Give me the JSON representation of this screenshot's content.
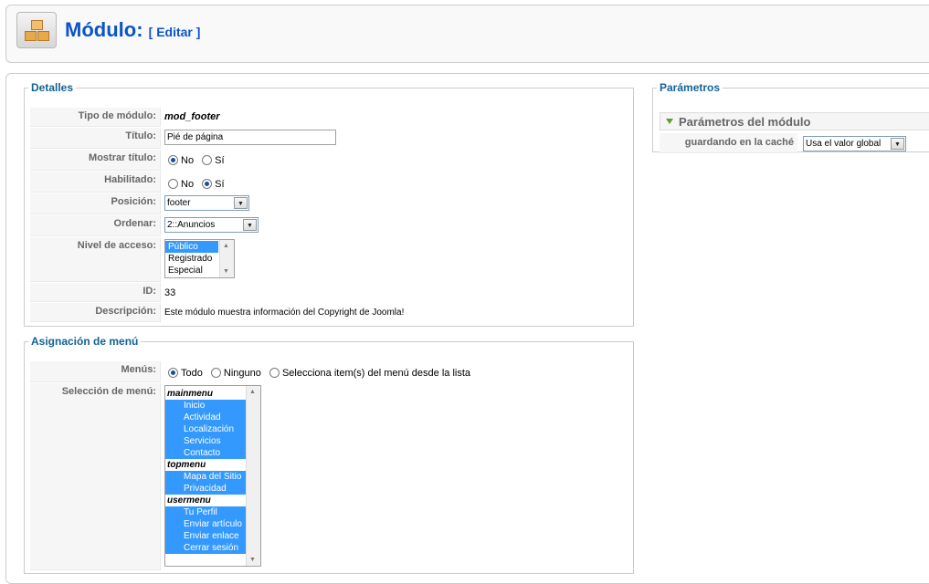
{
  "header": {
    "title": "Módulo:",
    "subtitle": "[ Editar ]",
    "icon": "module-icon"
  },
  "details": {
    "legend": "Detalles",
    "rows": {
      "tipo": {
        "label": "Tipo de módulo:",
        "value": "mod_footer"
      },
      "titulo": {
        "label": "Título:",
        "value": "Pié de página"
      },
      "mostrar": {
        "label": "Mostrar título:",
        "options": [
          "No",
          "Sí"
        ],
        "selected": "No"
      },
      "habilitado": {
        "label": "Habilitado:",
        "options": [
          "No",
          "Sí"
        ],
        "selected": "Sí"
      },
      "posicion": {
        "label": "Posición:",
        "value": "footer"
      },
      "ordenar": {
        "label": "Ordenar:",
        "value": "2::Anuncios"
      },
      "acceso": {
        "label": "Nivel de acceso:",
        "options": [
          "Público",
          "Registrado",
          "Especial"
        ],
        "selected": "Público"
      },
      "id": {
        "label": "ID:",
        "value": "33"
      },
      "descripcion": {
        "label": "Descripción:",
        "value": "Este módulo muestra información del Copyright de Joomla!"
      }
    }
  },
  "menu_assignment": {
    "legend": "Asignación de menú",
    "menus": {
      "label": "Menús:",
      "options": [
        "Todo",
        "Ninguno",
        "Selecciona item(s) del menú desde la lista"
      ],
      "selected": "Todo"
    },
    "seleccion": {
      "label": "Selección de menú:",
      "groups": [
        {
          "name": "mainmenu",
          "items": [
            "Inicio",
            "Actividad",
            "Localización",
            "Servicios",
            "Contacto"
          ]
        },
        {
          "name": "topmenu",
          "items": [
            "Mapa del Sitio",
            "Privacidad"
          ]
        },
        {
          "name": "usermenu",
          "items": [
            "Tu Perfil",
            "Enviar artículo",
            "Enviar enlace",
            "Cerrar sesión"
          ]
        }
      ]
    }
  },
  "params": {
    "legend": "Parámetros",
    "section": "Parámetros del módulo",
    "cache": {
      "label": "guardando en la caché",
      "value": "Usa el valor global"
    }
  },
  "colors": {
    "title_blue": "#0b55c4",
    "legend_blue": "#146295",
    "selection": "#3399ff"
  }
}
